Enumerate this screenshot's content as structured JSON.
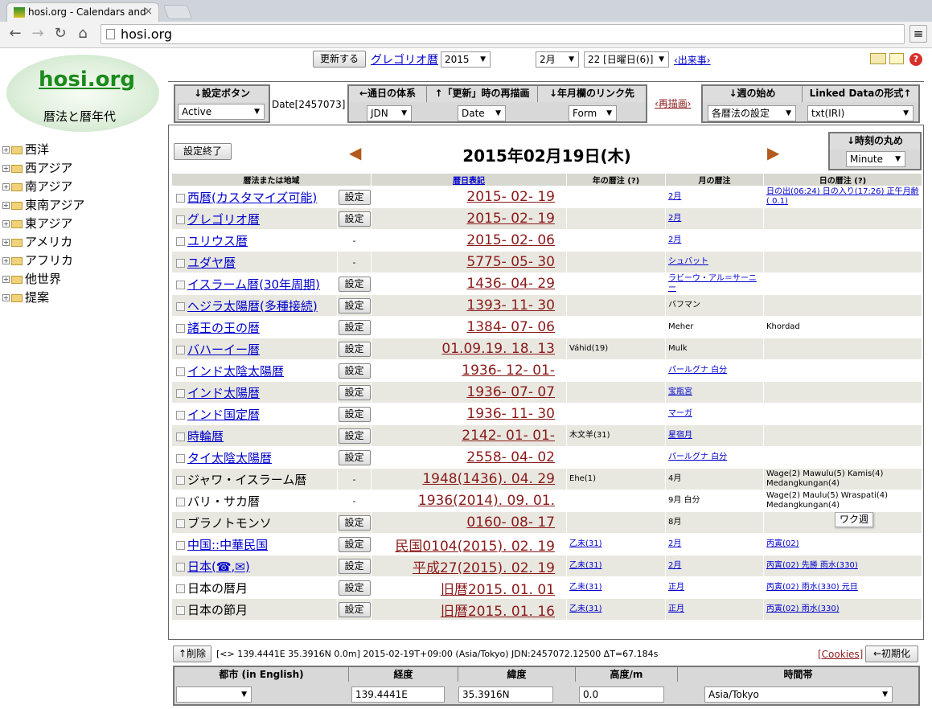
{
  "browser": {
    "tab_title": "hosi.org - Calendars and",
    "url": "hosi.org"
  },
  "logo": {
    "title": "hosi.org",
    "subtitle": "暦法と暦年代"
  },
  "sidebar": {
    "items": [
      "西洋",
      "西アジア",
      "南アジア",
      "東南アジア",
      "東アジア",
      "アメリカ",
      "アフリカ",
      "他世界",
      "提案"
    ]
  },
  "topbar": {
    "update_button": "更新する",
    "calendar_link": "グレゴリオ暦",
    "year": "2015",
    "month": "2月",
    "day": "22 [日曜日(6)]",
    "events_link": "‹出来事›"
  },
  "controls": {
    "settings_button": {
      "head": "↓設定ボタン",
      "value": "Active"
    },
    "date_label": "Date[2457073]",
    "day_system": {
      "head": "←通日の体系",
      "value": "JDN"
    },
    "redraw_on_update": {
      "head": "↑「更新」時の再描画",
      "value": "Date"
    },
    "link_target": {
      "head": "↓年月欄のリンク先",
      "value": "Form"
    },
    "redraw_link": "‹再描画›",
    "week_start": {
      "head": "↓週の始め",
      "value": "各暦法の設定"
    },
    "linked_data": {
      "head": "Linked Dataの形式↑",
      "value": "txt(IRI)"
    }
  },
  "panel": {
    "end_settings": "設定終了",
    "date_heading": "2015年02月19日(木)",
    "rounding": {
      "head": "↓時刻の丸め",
      "value": "Minute"
    },
    "columns": [
      "暦法または地域",
      "暦日表記",
      "年の暦注 (?)",
      "月の暦注",
      "日の暦注 (?)"
    ],
    "rows": [
      {
        "name": "西暦(カスタマイズ可能)",
        "link": true,
        "btn": "設定",
        "date": "2015- 02- 19",
        "year": "",
        "month": "2月",
        "month_link": true,
        "day": "日の出(06:24) 日の入り(17:26) 正午月齢( 0.1)",
        "day_link": true
      },
      {
        "name": "グレゴリオ暦",
        "link": true,
        "btn": "設定",
        "date": "2015- 02- 19",
        "year": "",
        "month": "2月",
        "month_link": true,
        "day": "",
        "day_link": false
      },
      {
        "name": "ユリウス暦",
        "link": true,
        "btn": "-",
        "date": "2015- 02- 06",
        "year": "",
        "month": "2月",
        "month_link": true,
        "day": "",
        "day_link": false
      },
      {
        "name": "ユダヤ暦",
        "link": true,
        "btn": "-",
        "date": "5775- 05- 30",
        "year": "",
        "month": "シュバット",
        "month_link": true,
        "day": "",
        "day_link": false
      },
      {
        "name": "イスラーム暦(30年周期)",
        "link": true,
        "btn": "設定",
        "date": "1436- 04- 29",
        "year": "",
        "month": "ラビーウ・アル＝サーニー",
        "month_link": true,
        "day": "",
        "day_link": false
      },
      {
        "name": "ヘジラ太陽暦(多種接続)",
        "link": true,
        "btn": "設定",
        "date": "1393- 11- 30",
        "year": "",
        "month": "バフマン",
        "month_link": false,
        "day": "",
        "day_link": false
      },
      {
        "name": "諸王の王の暦",
        "link": true,
        "btn": "設定",
        "date": "1384- 07- 06",
        "year": "",
        "month": "Meher",
        "month_link": false,
        "day": "Khordad",
        "day_link": false
      },
      {
        "name": "バハーイー暦",
        "link": true,
        "btn": "設定",
        "date": "01.09.19. 18. 13",
        "year": "Váhid(19)",
        "month": "Mulk",
        "month_link": false,
        "day": "",
        "day_link": false
      },
      {
        "name": "インド太陰太陽暦",
        "link": true,
        "btn": "設定",
        "date": "1936- 12- 01-",
        "year": "",
        "month": "パールグナ 白分",
        "month_link": true,
        "day": "",
        "day_link": false
      },
      {
        "name": "インド太陽暦",
        "link": true,
        "btn": "設定",
        "date": "1936- 07- 07",
        "year": "",
        "month": "宝瓶宮",
        "month_link": true,
        "day": "",
        "day_link": false
      },
      {
        "name": "インド国定暦",
        "link": true,
        "btn": "設定",
        "date": "1936- 11- 30",
        "year": "",
        "month": "マーガ",
        "month_link": true,
        "day": "",
        "day_link": false
      },
      {
        "name": "時輪暦",
        "link": true,
        "btn": "設定",
        "date": "2142- 01- 01-",
        "year": "木文羊(31)",
        "month": "星宿月",
        "month_link": true,
        "day": "",
        "day_link": false
      },
      {
        "name": "タイ太陰太陽暦",
        "link": true,
        "btn": "設定",
        "date": "2558- 04- 02",
        "year": "",
        "month": "パールグナ 白分",
        "month_link": true,
        "day": "",
        "day_link": false
      },
      {
        "name": "ジャワ・イスラーム暦",
        "link": false,
        "btn": "-",
        "date": "1948(1436). 04. 29",
        "year": "Ehe(1)",
        "month": "4月",
        "month_link": false,
        "day": "Wage(2) Mawulu(5) Kamis(4) Medangkungan(4)",
        "day_link": false
      },
      {
        "name": "バリ・サカ暦",
        "link": false,
        "btn": "-",
        "date": "1936(2014). 09. 01.",
        "year": "",
        "month": "9月 白分",
        "month_link": false,
        "day": "Wage(2) Maulu(5) Wraspati(4) Medangkungan(4)",
        "day_link": false
      },
      {
        "name": "ブラノトモンソ",
        "link": false,
        "btn": "設定",
        "date": "0160- 08- 17",
        "year": "",
        "month": "8月",
        "month_link": false,
        "day": "",
        "day_link": false
      },
      {
        "name": "中国::中華民国",
        "link": true,
        "btn": "設定",
        "date": "民国0104(2015). 02. 19",
        "year": "乙未(31)",
        "month": "2月",
        "month_link": true,
        "day": "丙寅(02)",
        "day_link": true
      },
      {
        "name": "日本(☎,✉)",
        "link": true,
        "btn": "設定",
        "date": "平成27(2015). 02. 19",
        "year": "乙未(31)",
        "month": "2月",
        "month_link": true,
        "day": "丙寅(02) 先勝 雨水(330)",
        "day_link": true
      },
      {
        "name": "日本の暦月",
        "link": false,
        "btn": "設定",
        "date": "旧暦2015. 01. 01",
        "year": "乙未(31)",
        "month": "正月",
        "month_link": true,
        "day": "丙寅(02) 雨水(330) 元日",
        "day_link": true
      },
      {
        "name": "日本の節月",
        "link": false,
        "btn": "設定",
        "date": "旧暦2015. 01. 16",
        "year": "乙未(31)",
        "month": "正月",
        "month_link": true,
        "day": "丙寅(02) 雨水(330)",
        "day_link": true
      }
    ]
  },
  "status": {
    "delete_button": "↑削除",
    "location_text": "[<> 139.4441E 35.3916N 0.0m] 2015-02-19T+09:00 (Asia/Tokyo) JDN:2457072.12500 ΔT=67.184s",
    "cookies_link": "[Cookies]",
    "reset_button": "←初期化"
  },
  "location": {
    "city_head": "都市 (in English)",
    "lon_head": "経度",
    "lat_head": "緯度",
    "alt_head": "高度/m",
    "tz_head": "時間帯",
    "lon": "139.4441E",
    "lat": "35.3916N",
    "alt": "0.0",
    "tz": "Asia/Tokyo"
  },
  "tooltip": "ワク週"
}
